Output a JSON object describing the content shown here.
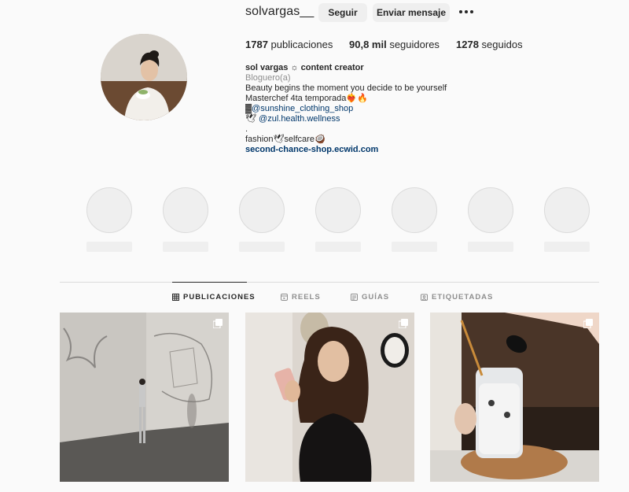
{
  "profile": {
    "username": "solvargas__",
    "follow_label": "Seguir",
    "message_label": "Enviar mensaje",
    "stats": {
      "posts_count": "1787",
      "posts_label": "publicaciones",
      "followers_count": "90,8 mil",
      "followers_label": "seguidores",
      "following_count": "1278",
      "following_label": "seguidos"
    },
    "bio": {
      "name": "sol vargas ☼ content creator",
      "category": "Bloguero(a)",
      "line1": "Beauty begins the moment you decide to be yourself",
      "line2": "Masterchef 4ta temporada❤️‍🔥🔥",
      "line3_prefix": "▓",
      "line3_tag": "@sunshine_clothing_shop",
      "line4_prefix": "🕊",
      "line4_tag": "@zul.health.wellness",
      "line5": ".",
      "line6": "fashion🕊selfcare🥥",
      "link": "second-chance-shop.ecwid.com"
    }
  },
  "highlights_count": 7,
  "tabs": [
    {
      "label": "PUBLICACIONES",
      "icon": "grid-icon",
      "active": true
    },
    {
      "label": "REELS",
      "icon": "reels-icon",
      "active": false
    },
    {
      "label": "GUÍAS",
      "icon": "guides-icon",
      "active": false
    },
    {
      "label": "ETIQUETADAS",
      "icon": "tagged-icon",
      "active": false
    }
  ],
  "posts": [
    {
      "icon": "carousel-icon"
    },
    {
      "icon": "carousel-icon"
    },
    {
      "icon": "carousel-icon"
    }
  ],
  "colors": {
    "background": "#fafafa",
    "button_bg": "#efefef",
    "link": "#00376b",
    "muted": "#8e8e8e"
  }
}
